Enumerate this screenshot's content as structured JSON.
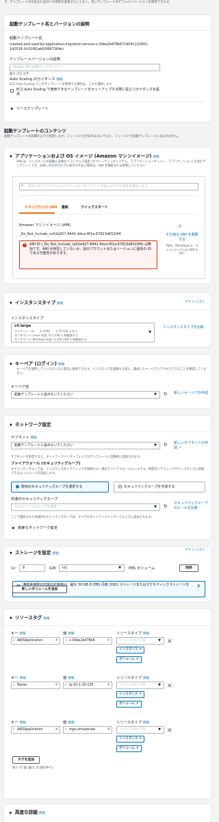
{
  "top_note": "り、テンプレートの名前またはIDへの参照を変更することなく、常にテンプレートのデフォルトバージョンを使用できます。",
  "tpl": {
    "title": "起動テンプレート名とバージョンの説明",
    "name_label": "起動テンプレート名",
    "name_value": "created-and-used-by-application-migration-service-s-34be2b478b67c904f-222601-142518 (lt-01f81ab02f687364e)",
    "ver_label": "テンプレートバージョンの説明",
    "ver_placeholder": "MyApp 用の本番ウェブサーバー",
    "max_chars": "最大 255 文字",
    "as_label": "Auto Scaling のガイダンス",
    "info": "情報",
    "as_desc": "EC2 Auto Scaling でこのテンプレートを使用する場合は、これを選択します",
    "as_check": "EC2 Auto Scaling で使用できるテンプレートをセットアップする際に役立つガイダンスを提供",
    "source": "ソーステンプレート"
  },
  "contents": {
    "title": "起動テンプレートのコンテンツ",
    "desc": "起動テンプレートの詳細を以下で指定します。フィールドを空白のままにすると、フィールドが起動テンプレートに含まれません。"
  },
  "ami": {
    "title": "アプリケーションおよび OS イメージ (Amazon マシンイメージ)",
    "info": "情報",
    "desc": "AMI は、インスタンスの起動に必要なソフトウェア設定 (オペレーティングシステム、アプリケーションサーバー、アプリケーション) を含むテンプレートです。お探しのものが以下に表示されない場合は、AMI を検索または参照してください",
    "search_placeholder": "何千ものアプリケーションイメージと OS イメージを含むカタログ全体を検索します。",
    "tabs": [
      "カタログからの AMI",
      "最新",
      "クイックスタート"
    ],
    "ami_label": "Amazon マシンイメージ (AMI)",
    "ami_value": "_Do_Not_Include_ce52e927-8441-4dca-8f1a-67823d6520f4",
    "error": "AMI ID (_Do_Not_Include_ce52e927-8441-4dca-8f1a-67823d6520f4) は無効です。AMI が存在していないか、別のアカウントまたはリージョンに固有の ID である可能性があります。",
    "more_link": "その他の AMI を閲覧する",
    "more_desc": "AWS、Marketplace、コミュニティからの AMI を含む"
  },
  "instance": {
    "title": "インスタンスタイプ",
    "info": "情報",
    "advanced": "アドバンスト",
    "label": "インスタンスタイプ",
    "type": "c4.large",
    "line1": "ファミリー: c4　　2 vCPU　　3.75 GiB メモリ",
    "line2": "オンデマンド Linux 料金: 0.1 USD 1 時間あたり",
    "line3": "オンデマンド Windows 料金: 0.192 USD 1 時間あたり",
    "compare": "インスタンスタイプを比較"
  },
  "keypair": {
    "title": "キーペア (ログイン)",
    "info": "情報",
    "desc": "キーペアを使用してインスタンスに安全に接続できます。インスタンスを起動する前に、選択したキーペアにアクセスできることを確認してください。",
    "label": "キーペア名",
    "value": "起動テンプレートに含めないでください",
    "create": "新しいキーペアの作成"
  },
  "network": {
    "title": "ネットワーク設定",
    "subnet_label": "サブネット",
    "info": "情報",
    "subnet_value": "起動テンプレートに含めないでください",
    "create_subnet": "新しいサブネットの作成",
    "subnet_note": "サブネットを指定すると、ネットワークインターフェイスがテンプレートに自動的に追加されます。",
    "fw_title": "ファイアウォール (セキュリティグループ)",
    "fw_desc": "セキュリティグループは、インスタンスのトラフィックを制御する一連のファイアウォールルールです。特定のトラフィックがインスタンスに到達できるようにルールを追加します。",
    "radio_existing": "既存のセキュリティグループを選択する",
    "radio_create": "セキュリティグループを作成する",
    "sg_label": "共通のセキュリティグループ",
    "sg_placeholder": "セキュリティグループを選択",
    "compare_rules": "セキュリティグループのルールを比較",
    "sg_note": "ここで選択された共通のセキュリティグループは、すべてのネットワークインターフェイスに追加されます。",
    "advanced": "高度なネットワーク設定"
  },
  "storage": {
    "title": "ストレージを設定",
    "info": "情報",
    "advanced": "アドバンスト",
    "count": "1x",
    "size": "8",
    "unit": "GiB",
    "type": "io1",
    "vol": "EBS ボリューム",
    "delete": "削除",
    "notice": "無料利用枠の対象のお客様は、最大 30 GB の EBS 汎用 (SSD) ストレージまたはマグネティックストレージを取得できます。",
    "add": "新しいボリュームを追加"
  },
  "tags": {
    "title": "リソースタグ",
    "info": "情報",
    "key_label": "キー",
    "value_label": "値",
    "rt_label": "リソースタイプ",
    "rt_placeholder": "リソースタイプを",
    "instance_chip": "インスタンス",
    "volume_chip": "ボリューム",
    "rows": [
      {
        "key": "AWSApplication",
        "value": "s-34be2b478b6"
      },
      {
        "key": "Name",
        "value": "ip-10-1-10-135"
      },
      {
        "key": "AWSApplication",
        "value": "mgn.amazonaw"
      }
    ],
    "add": "タグを追加",
    "remaining": "残り 47 個 (最大 50 個の中で)"
  },
  "advanced": {
    "title": "高度な詳細",
    "info": "情報"
  }
}
